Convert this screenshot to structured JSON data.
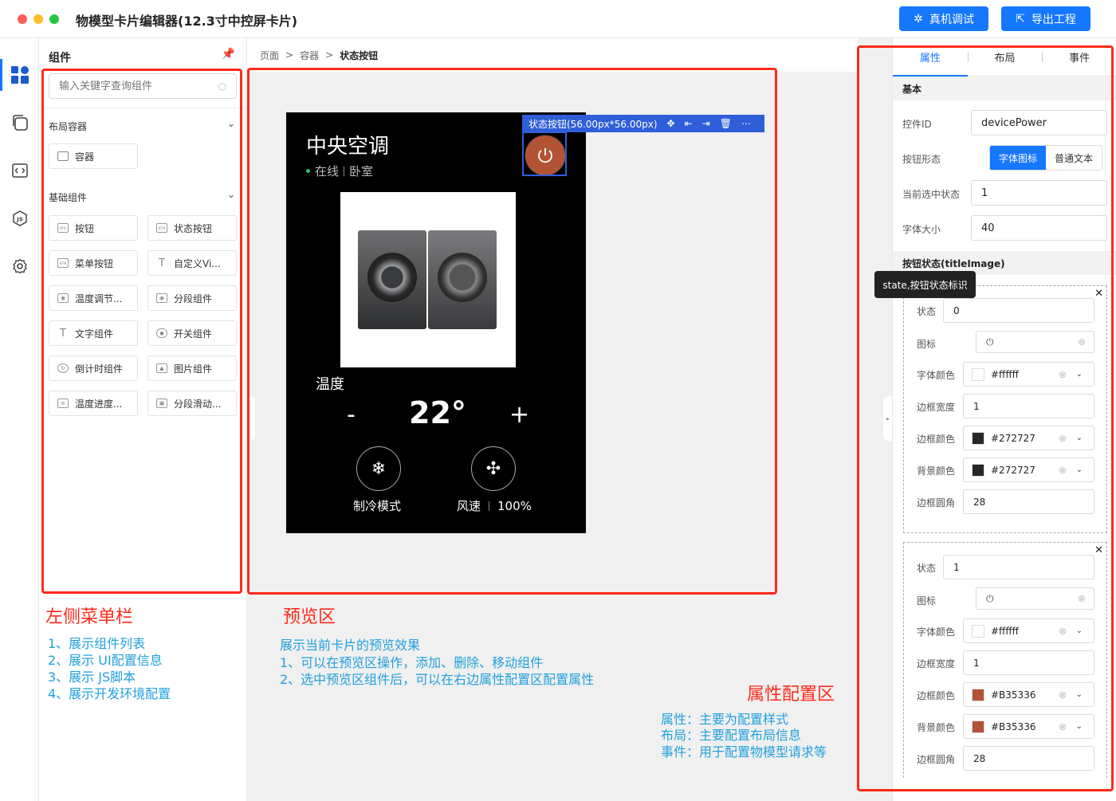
{
  "app": {
    "title": "物模型卡片编辑器(12.3寸中控屏卡片)",
    "debug_button": "真机调试",
    "export_button": "导出工程"
  },
  "components_panel": {
    "title": "组件",
    "search_placeholder": "输入关键字查询组件",
    "groups": [
      {
        "title": "布局容器",
        "items": [
          {
            "label": "容器",
            "icon": "checkbox-icon"
          }
        ]
      },
      {
        "title": "基础组件",
        "items": [
          {
            "label": "按钮",
            "icon": "btn-icon"
          },
          {
            "label": "状态按钮",
            "icon": "btn-icon"
          },
          {
            "label": "菜单按钮",
            "icon": "btn-icon"
          },
          {
            "label": "自定义Vi...",
            "icon": "text-icon"
          },
          {
            "label": "温度调节...",
            "icon": "eye-icon"
          },
          {
            "label": "分段组件",
            "icon": "eye-icon"
          },
          {
            "label": "文字组件",
            "icon": "text-icon"
          },
          {
            "label": "开关组件",
            "icon": "toggle-icon"
          },
          {
            "label": "倒计时组件",
            "icon": "timer-icon"
          },
          {
            "label": "图片组件",
            "icon": "image-icon"
          },
          {
            "label": "温度进度...",
            "icon": "slider-icon"
          },
          {
            "label": "分段滑动...",
            "icon": "segment-icon"
          }
        ]
      }
    ]
  },
  "breadcrumb": [
    "页面",
    "容器",
    "状态按钮"
  ],
  "selection": {
    "label": "状态按钮(56.00px*56.00px)"
  },
  "device": {
    "title": "中央空调",
    "status": "在线",
    "room": "卧室",
    "temp_label": "温度",
    "minus": "-",
    "temp_value": "22°",
    "plus": "+",
    "mode_label": "制冷模式",
    "fan_label": "风速",
    "fan_value": "100%",
    "power_color": "#B35336"
  },
  "annotations": {
    "left_title": "左侧菜单栏",
    "left_lines": [
      "1、展示组件列表",
      "2、展示 UI配置信息",
      "3、展示 JS脚本",
      "4、展示开发环境配置"
    ],
    "preview_title": "预览区",
    "preview_lines": [
      "展示当前卡片的预览效果",
      "1、可以在预览区操作，添加、删除、移动组件",
      "2、选中预览区组件后，可以在右边属性配置区配置属性"
    ],
    "props_title": "属性配置区",
    "props_lines": [
      "属性：主要为配置样式",
      "布局：主要配置布局信息",
      "事件：用于配置物模型请求等"
    ]
  },
  "props": {
    "tabs": [
      "属性",
      "布局",
      "事件"
    ],
    "basic_title": "基本",
    "control_id_label": "控件ID",
    "control_id": "devicePower",
    "shape_label": "按钮形态",
    "shape_options": [
      "字体图标",
      "普通文本"
    ],
    "current_state_label": "当前选中状态",
    "current_state": "1",
    "font_size_label": "字体大小",
    "font_size": "40",
    "states_title": "按钮状态(titleImage)",
    "tooltip": "state,按钮状态标识",
    "labels": {
      "state": "状态",
      "icon": "图标",
      "font_color": "字体颜色",
      "border_width": "边框宽度",
      "border_color": "边框颜色",
      "bg_color": "背景颜色",
      "radius": "边框圆角"
    },
    "states": [
      {
        "state": "0",
        "font_color": "#ffffff",
        "border_width": "1",
        "border_color": "#272727",
        "bg_color": "#272727",
        "radius": "28"
      },
      {
        "state": "1",
        "font_color": "#ffffff",
        "border_width": "1",
        "border_color": "#B35336",
        "bg_color": "#B35336",
        "radius": "28"
      }
    ]
  }
}
